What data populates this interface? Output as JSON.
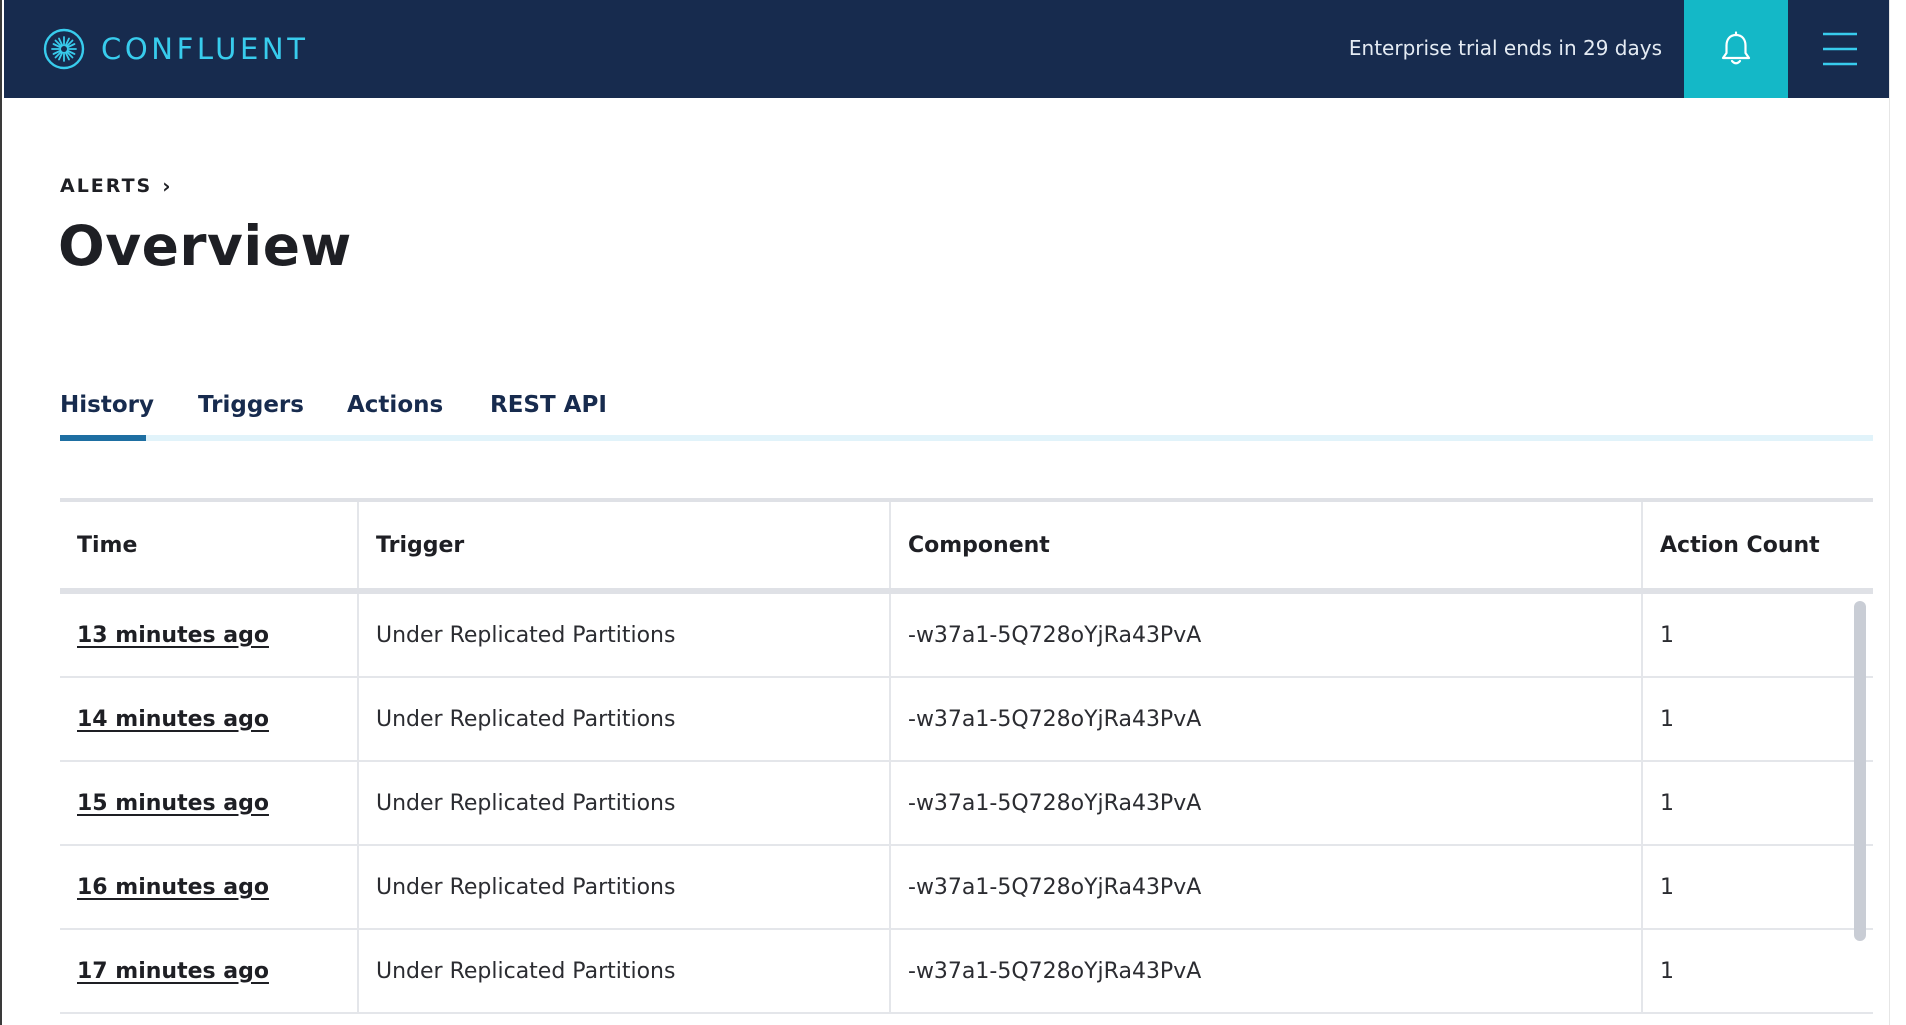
{
  "app": {
    "logo_text": "CONFLUENT",
    "trial_text": "Enterprise trial ends in 29 days"
  },
  "icons": {
    "logo": "confluent-logo-icon",
    "bell": "bell-icon",
    "menu": "hamburger-menu-icon",
    "breadcrumb_chevron": "chevron-right-icon"
  },
  "colors": {
    "topbar": "#172b4e",
    "brand_accent": "#38cced",
    "bell_bg": "#14b8c7",
    "tab_active": "#1e6fa2",
    "tab_track": "#e1f3fa"
  },
  "breadcrumb": {
    "label": "ALERTS",
    "chevron": "›"
  },
  "page": {
    "title": "Overview"
  },
  "tabs": [
    {
      "label": "History",
      "active": true
    },
    {
      "label": "Triggers",
      "active": false
    },
    {
      "label": "Actions",
      "active": false
    },
    {
      "label": "REST API",
      "active": false
    }
  ],
  "table": {
    "columns": [
      "Time",
      "Trigger",
      "Component",
      "Action Count"
    ],
    "rows": [
      {
        "time": "13 minutes ago",
        "trigger": "Under Replicated Partitions",
        "component": "-w37a1-5Q728oYjRa43PvA",
        "action_count": "1"
      },
      {
        "time": "14 minutes ago",
        "trigger": "Under Replicated Partitions",
        "component": "-w37a1-5Q728oYjRa43PvA",
        "action_count": "1"
      },
      {
        "time": "15 minutes ago",
        "trigger": "Under Replicated Partitions",
        "component": "-w37a1-5Q728oYjRa43PvA",
        "action_count": "1"
      },
      {
        "time": "16 minutes ago",
        "trigger": "Under Replicated Partitions",
        "component": "-w37a1-5Q728oYjRa43PvA",
        "action_count": "1"
      },
      {
        "time": "17 minutes ago",
        "trigger": "Under Replicated Partitions",
        "component": "-w37a1-5Q728oYjRa43PvA",
        "action_count": "1"
      }
    ]
  }
}
